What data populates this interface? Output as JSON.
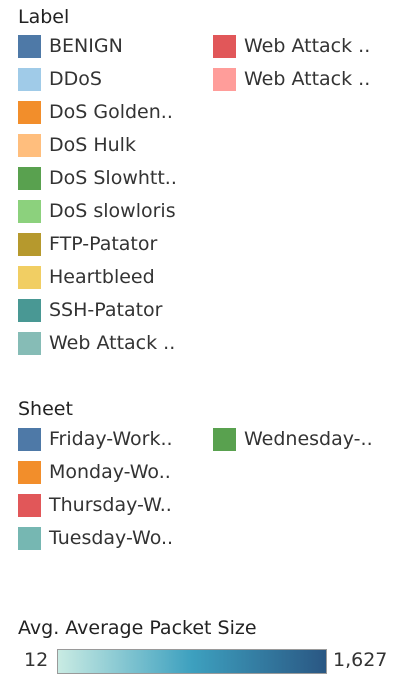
{
  "label_legend": {
    "title": "Label",
    "items": [
      {
        "label": "BENIGN",
        "color": "#4e79a7"
      },
      {
        "label": "DDoS",
        "color": "#a0cbe8"
      },
      {
        "label": "DoS Golden..",
        "color": "#f28e2b"
      },
      {
        "label": "DoS Hulk",
        "color": "#ffbe7d"
      },
      {
        "label": "DoS Slowhtt..",
        "color": "#59a14f"
      },
      {
        "label": "DoS slowloris",
        "color": "#8cd17d"
      },
      {
        "label": "FTP-Patator",
        "color": "#b6992d"
      },
      {
        "label": "Heartbleed",
        "color": "#f1ce63"
      },
      {
        "label": "SSH-Patator",
        "color": "#499894"
      },
      {
        "label": "Web Attack ..",
        "color": "#86bcb6"
      },
      {
        "label": "Web Attack ..",
        "color": "#e15759"
      },
      {
        "label": "Web Attack ..",
        "color": "#ff9d9a"
      }
    ]
  },
  "sheet_legend": {
    "title": "Sheet",
    "items": [
      {
        "label": "Friday-Work..",
        "color": "#4e79a7"
      },
      {
        "label": "Monday-Wo..",
        "color": "#f28e2b"
      },
      {
        "label": "Thursday-W..",
        "color": "#e15759"
      },
      {
        "label": "Tuesday-Wo..",
        "color": "#76b7b2"
      },
      {
        "label": "Wednesday-..",
        "color": "#59a14f"
      }
    ]
  },
  "gradient_legend": {
    "title": "Avg. Average Packet Size",
    "min": "12",
    "max": "1,627",
    "color_start": "#c9ebe3",
    "color_mid": "#3da0bf",
    "color_end": "#2a5783"
  }
}
